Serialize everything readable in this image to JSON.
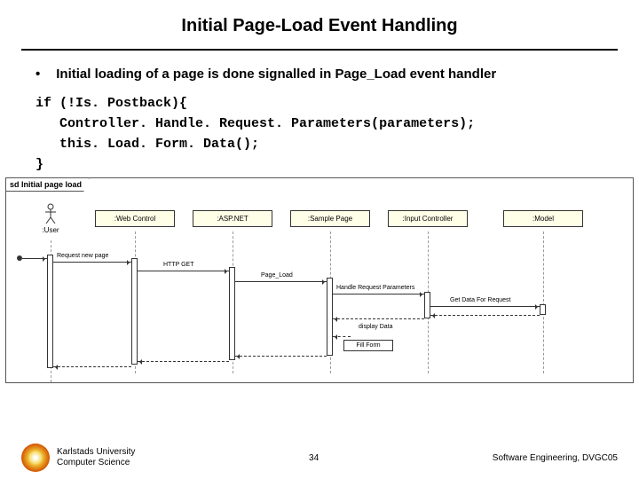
{
  "title": "Initial Page-Load Event Handling",
  "bullet_text": "Initial loading of a page is done signalled in Page_Load event handler",
  "code_lines": [
    "if (!Is. Postback){",
    "   Controller. Handle. Request. Parameters(parameters);",
    "   this. Load. Form. Data();",
    "}"
  ],
  "diagram": {
    "frame_label": "sd Initial page load",
    "actor": ":User",
    "objects": [
      ":Web Control",
      ":ASP.NET",
      ":Sample Page",
      ":Input Controller",
      ":Model"
    ],
    "messages": {
      "request_page": "Request new page",
      "http_get": "HTTP GET",
      "page_load": "Page_Load",
      "handle_params": "Handle Request Parameters",
      "get_data": "Get Data For Request",
      "display_data": "display Data",
      "fill_form": "Fill Form"
    }
  },
  "footer": {
    "uni_line1": "Karlstads University",
    "uni_line2": "Computer Science",
    "page_number": "34",
    "course": "Software Engineering, DVGC05"
  }
}
